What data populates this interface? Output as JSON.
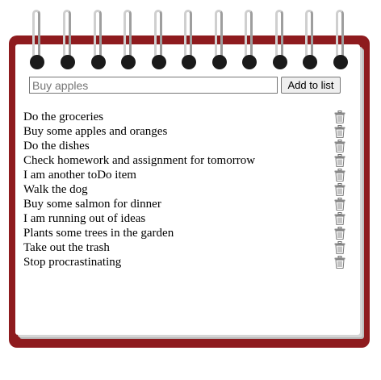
{
  "add_form": {
    "input_value": "",
    "placeholder": "Buy apples",
    "button_label": "Add to list"
  },
  "todos": [
    {
      "text": "Do the groceries"
    },
    {
      "text": "Buy some apples and oranges"
    },
    {
      "text": "Do the dishes"
    },
    {
      "text": "Check homework and assignment for tomorrow"
    },
    {
      "text": "I am another toDo item"
    },
    {
      "text": "Walk the dog"
    },
    {
      "text": "Buy some salmon for dinner"
    },
    {
      "text": "I am running out of ideas"
    },
    {
      "text": "Plants some trees in the garden"
    },
    {
      "text": "Take out the trash"
    },
    {
      "text": "Stop procrastinating"
    }
  ],
  "icons": {
    "delete": "trash-icon"
  },
  "colors": {
    "notepad_cover": "#8e1b1e",
    "paper": "#ffffff",
    "ring_hole": "#1a1a1a",
    "ring_wire": "#cfcfcf"
  }
}
